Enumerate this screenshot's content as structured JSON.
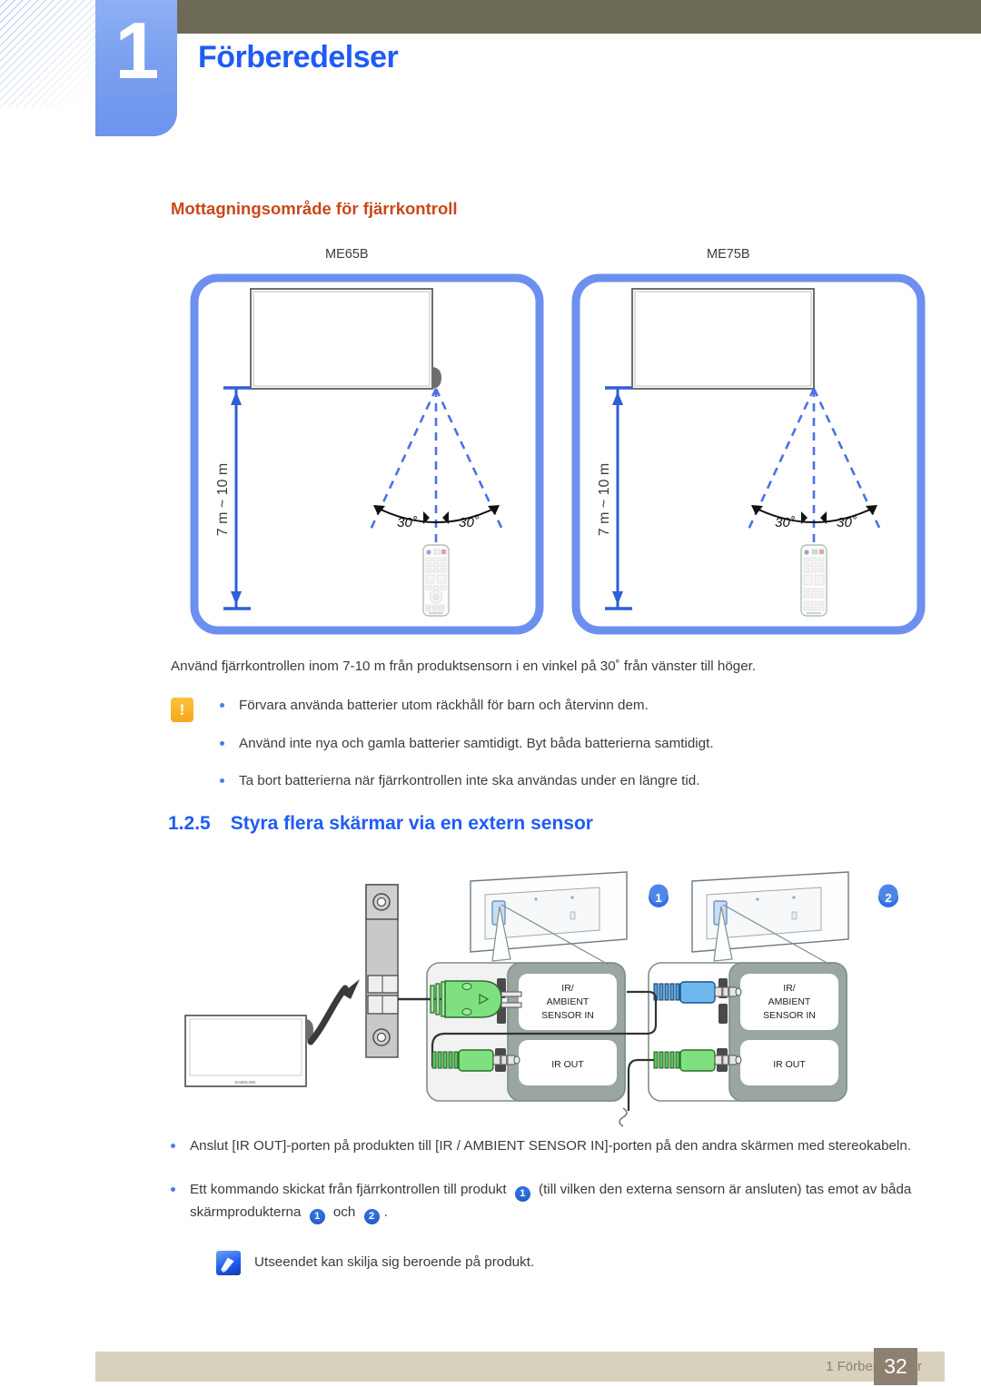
{
  "header": {
    "chapter_number": "1",
    "chapter_title": "Förberedelser"
  },
  "sub_heading": "Mottagningsområde för fjärrkontroll",
  "remote_range_diagrams": [
    {
      "model": "ME65B",
      "distance_label": "7 m ~ 10 m",
      "angle_left": "30˚",
      "angle_right": "30˚"
    },
    {
      "model": "ME75B",
      "distance_label": "7 m ~ 10 m",
      "angle_left": "30˚",
      "angle_right": "30˚"
    }
  ],
  "intro_paragraph": "Använd fjärrkontrollen inom 7-10 m från produktsensorn i en vinkel på 30˚ från vänster till höger.",
  "caution": {
    "icon": "exclamation-icon",
    "items": [
      "Förvara använda batterier utom räckhåll för barn och återvinn dem.",
      "Använd inte nya och gamla batterier samtidigt. Byt båda batterierna samtidigt.",
      "Ta bort batterierna när fjärrkontrollen inte ska användas under en längre tid."
    ]
  },
  "section": {
    "number": "1.2.5",
    "title": "Styra flera skärmar via en extern sensor"
  },
  "sensor_diagram": {
    "badge_1": "1",
    "badge_2": "2",
    "port_labels": {
      "sensor_in_line1": "IR/",
      "sensor_in_line2": "AMBIENT",
      "sensor_in_line3": "SENSOR IN",
      "ir_out": "IR OUT"
    },
    "display_brand": "SAMSUNG"
  },
  "bottom_bullets": [
    {
      "parts": [
        {
          "t": "text",
          "v": "Anslut [IR OUT]-porten på produkten till [IR / AMBIENT SENSOR IN]-porten på den andra skärmen med stereokabeln."
        }
      ]
    },
    {
      "parts": [
        {
          "t": "text",
          "v": "Ett kommando skickat från fjärrkontrollen till produkt "
        },
        {
          "t": "num",
          "v": "1"
        },
        {
          "t": "text",
          "v": " (till vilken den externa sensorn är ansluten) tas emot av båda skärmprodukterna "
        },
        {
          "t": "num",
          "v": "1"
        },
        {
          "t": "text",
          "v": " och "
        },
        {
          "t": "num",
          "v": "2"
        },
        {
          "t": "text",
          "v": "."
        }
      ]
    }
  ],
  "note": {
    "icon": "note-pen-icon",
    "text": "Utseendet kan skilja sig beroende på produkt."
  },
  "footer": {
    "label": "1 Förberedelser",
    "page": "32"
  },
  "colors": {
    "accent_blue": "#1f5cf5",
    "tab_blue": "#7ba0ef",
    "olive": "#6d6b55",
    "orange_heading": "#c9471b",
    "footer_bar": "#d7d1be",
    "footer_page": "#8c8071"
  }
}
